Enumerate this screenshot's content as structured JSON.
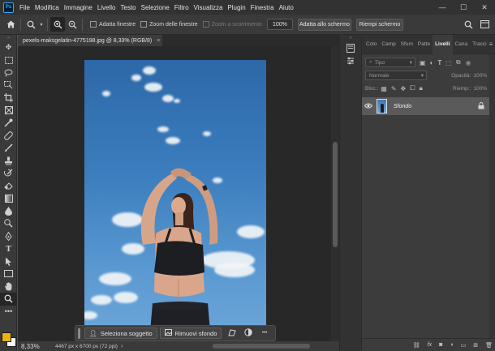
{
  "app": {
    "logo_text": "Ps"
  },
  "menu": [
    "File",
    "Modifica",
    "Immagine",
    "Livello",
    "Testo",
    "Selezione",
    "Filtro",
    "Visualizza",
    "Plugin",
    "Finestra",
    "Aiuto"
  ],
  "window_controls": [
    "minimize-icon",
    "maximize-icon",
    "close-icon"
  ],
  "options_bar": {
    "checkbox_fit_windows": "Adatta finestre",
    "checkbox_zoom_all": "Zoom delle finestre",
    "checkbox_scrubby_zoom": "Zoom a scorrimento",
    "zoom_value": "100%",
    "btn_fit_screen": "Adatta allo schermo",
    "btn_fill_screen": "Riempi schermo"
  },
  "document": {
    "tab_title": "pexels-maksgelatin-4775198.jpg @ 8,33% (RGB/8)",
    "tab_close": "×"
  },
  "contextual_taskbar": {
    "select_subject": "Seleziona soggetto",
    "remove_background": "Rimuovi sfondo",
    "more": "•••"
  },
  "status": {
    "zoom": "8,33%",
    "doc_info": "4467 px x 6700 px (72 ppi)",
    "arrow": "›"
  },
  "panel": {
    "tabs": [
      "Colo",
      "Camp",
      "Sfum",
      "Patte",
      "Livelli",
      "Cana",
      "Tracci"
    ],
    "active_tab": "Livelli",
    "filter_kind": "Tipo",
    "blend_mode": "Normale",
    "opacity_label": "Opacità:",
    "opacity_value": "100%",
    "lock_label": "Bloc.:",
    "fill_label": "Riemp.:",
    "fill_value": "100%",
    "layer_name": "Sfondo"
  },
  "colors": {
    "foreground": "#e8b313",
    "background": "#ffffff",
    "accent": "#31a8ff"
  }
}
